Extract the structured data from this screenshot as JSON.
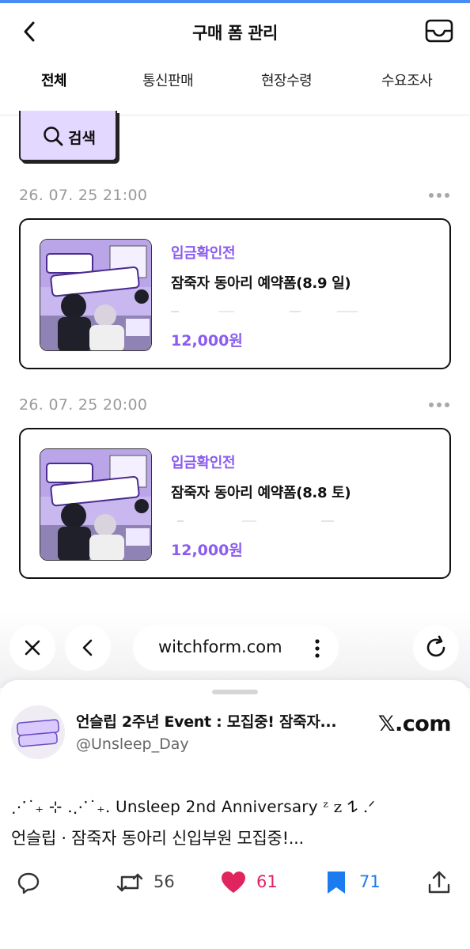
{
  "header": {
    "title": "구매 폼 관리"
  },
  "tabs": [
    {
      "label": "전체",
      "active": true
    },
    {
      "label": "통신판매",
      "active": false
    },
    {
      "label": "현장수령",
      "active": false
    },
    {
      "label": "수요조사",
      "active": false
    }
  ],
  "search": {
    "label": "검색"
  },
  "orders": [
    {
      "date": "26. 07. 25 21:00",
      "status": "입금확인전",
      "title": "잠죽자 동아리 예약폼(8.9 일)",
      "price": "12,000원"
    },
    {
      "date": "26. 07. 25 20:00",
      "status": "입금확인전",
      "title": "잠죽자 동아리 예약폼(8.8 토)",
      "price": "12,000원"
    }
  ],
  "browser": {
    "url": "witchform.com"
  },
  "tweet": {
    "name": "언슬립 2주년 Event : 모집중! 잠죽자...",
    "handle": "@Unsleep_Day",
    "source": "𝕏.com",
    "line1": "⋰˙₊ ⊹ .⋰˙₊. 𝖴𝗇𝗌𝗅𝖾𝖾𝗉 𝟤𝗇𝖽 𝖠𝗇𝗇𝗂𝗏𝖾𝗋𝗌𝖺𝗋𝗒 ᶻ z 𐰁 .ᐟ",
    "line2": "언슬립 · 잠죽자 동아리 신입부원 모집중!...",
    "retweets": "56",
    "likes": "61",
    "bookmarks": "71"
  },
  "colors": {
    "accent": "#8a5cf0",
    "search_bg": "#e3d8ff",
    "like": "#e0245e",
    "bookmark": "#1d7bf0"
  }
}
